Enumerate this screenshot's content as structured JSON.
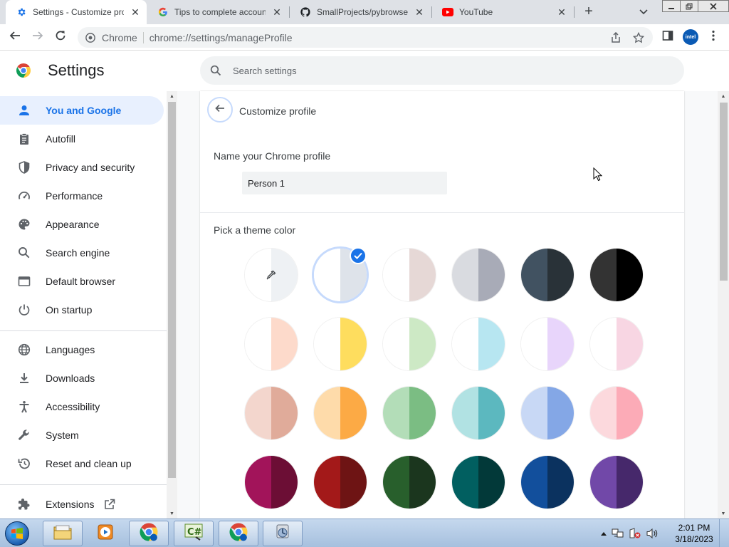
{
  "browser": {
    "tabs": [
      {
        "title": "Settings - Customize profile",
        "favicon": "gear-icon",
        "active": true
      },
      {
        "title": "Tips to complete account setup",
        "favicon": "google-icon",
        "active": false
      },
      {
        "title": "SmallProjects/pybrowser",
        "favicon": "github-icon",
        "active": false
      },
      {
        "title": "YouTube",
        "favicon": "youtube-icon",
        "active": false
      }
    ],
    "omnibox": {
      "chip": "Chrome",
      "url": "chrome://settings/manageProfile"
    },
    "profile_avatar_text": "intel"
  },
  "settings": {
    "title": "Settings",
    "search_placeholder": "Search settings",
    "nav": [
      {
        "label": "You and Google",
        "icon": "person-icon",
        "active": true
      },
      {
        "label": "Autofill",
        "icon": "clipboard-icon"
      },
      {
        "label": "Privacy and security",
        "icon": "shield-icon"
      },
      {
        "label": "Performance",
        "icon": "speedometer-icon"
      },
      {
        "label": "Appearance",
        "icon": "palette-icon"
      },
      {
        "label": "Search engine",
        "icon": "search-icon"
      },
      {
        "label": "Default browser",
        "icon": "browser-window-icon"
      },
      {
        "label": "On startup",
        "icon": "power-icon"
      },
      {
        "label": "Languages",
        "icon": "globe-icon"
      },
      {
        "label": "Downloads",
        "icon": "download-icon"
      },
      {
        "label": "Accessibility",
        "icon": "accessibility-icon"
      },
      {
        "label": "System",
        "icon": "wrench-icon"
      },
      {
        "label": "Reset and clean up",
        "icon": "restore-icon"
      },
      {
        "label": "Extensions",
        "icon": "puzzle-icon"
      }
    ]
  },
  "profile": {
    "header": "Customize profile",
    "name_label": "Name your Chrome profile",
    "name_value": "Person 1",
    "theme_label": "Pick a theme color",
    "swatches": [
      {
        "name": "custom-color",
        "left": "#ffffff",
        "right": "#eef1f4",
        "picker": true
      },
      {
        "name": "default",
        "left": "#ffffff",
        "right": "#dee3ea",
        "selected": true
      },
      {
        "name": "warm-grey",
        "left": "#ffffff",
        "right": "#e6d8d6"
      },
      {
        "name": "cool-grey",
        "left": "#d9dbe0",
        "right": "#a8abb7"
      },
      {
        "name": "midnight-blue",
        "left": "#415261",
        "right": "#293238"
      },
      {
        "name": "black",
        "left": "#333333",
        "right": "#000000"
      },
      {
        "name": "beige-white",
        "left": "#ffffff",
        "right": "#fddacb"
      },
      {
        "name": "yellow-white",
        "left": "#ffffff",
        "right": "#fedd5e"
      },
      {
        "name": "green-white",
        "left": "#ffffff",
        "right": "#cde9c5"
      },
      {
        "name": "light-teal-white",
        "left": "#ffffff",
        "right": "#b7e6f1"
      },
      {
        "name": "light-purple-white",
        "left": "#ffffff",
        "right": "#e8d5fb"
      },
      {
        "name": "pink-white",
        "left": "#ffffff",
        "right": "#f8d6e3"
      },
      {
        "name": "dark-beige",
        "left": "#f3d6cd",
        "right": "#e0ab9a"
      },
      {
        "name": "orange",
        "left": "#fedbaa",
        "right": "#fcaa45"
      },
      {
        "name": "light-green",
        "left": "#b3ddb8",
        "right": "#7bbd83"
      },
      {
        "name": "light-teal",
        "left": "#b1e2e3",
        "right": "#5cb8bf"
      },
      {
        "name": "light-blue",
        "left": "#c8d8f5",
        "right": "#84a7e6"
      },
      {
        "name": "light-pink",
        "left": "#fcd9dd",
        "right": "#fcabb7"
      },
      {
        "name": "dark-pink-red",
        "left": "#a2145a",
        "right": "#6c0e35"
      },
      {
        "name": "dark-red-orange",
        "left": "#a31919",
        "right": "#6e1414"
      },
      {
        "name": "dark-green",
        "left": "#285f2c",
        "right": "#1b361e"
      },
      {
        "name": "dark-teal",
        "left": "#015f60",
        "right": "#023939"
      },
      {
        "name": "dark-blue",
        "left": "#124f9c",
        "right": "#0b325f"
      },
      {
        "name": "purple",
        "left": "#7148a8",
        "right": "#46286b"
      }
    ]
  },
  "taskbar": {
    "time": "2:01 PM",
    "date": "3/18/2023",
    "apps": [
      "file-explorer-icon",
      "media-player-icon",
      "chrome-icon",
      "csharp-icon",
      "chrome-icon",
      "tool-icon"
    ]
  }
}
